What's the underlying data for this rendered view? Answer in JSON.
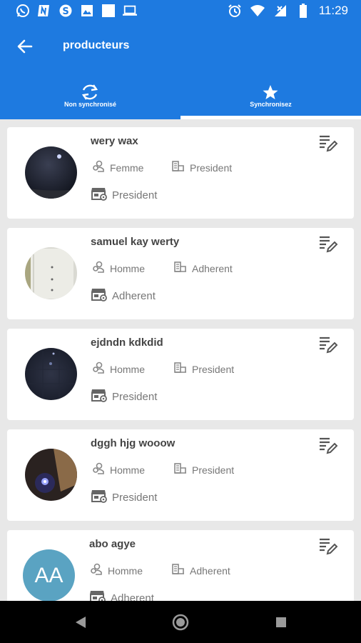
{
  "status_bar": {
    "time": "11:29",
    "left_icons": [
      "whatsapp-icon",
      "n-app-icon",
      "skype-icon",
      "image-icon",
      "square-icon",
      "laptop-icon"
    ],
    "right_icons": [
      "alarm-icon",
      "wifi-icon",
      "no-signal-icon",
      "battery-icon"
    ]
  },
  "app_bar": {
    "title": "producteurs",
    "back_icon": "arrow-back-icon"
  },
  "tabs": [
    {
      "label": "Non synchronisé",
      "icon": "sync-icon",
      "selected": false
    },
    {
      "label": "Synchronisez",
      "icon": "star-icon",
      "selected": true
    }
  ],
  "producers": [
    {
      "name": "wery wax",
      "gender": "Femme",
      "role": "President",
      "group_role": "President",
      "avatar": "photo"
    },
    {
      "name": "samuel kay werty",
      "gender": "Homme",
      "role": "Adherent",
      "group_role": "Adherent",
      "avatar": "photo"
    },
    {
      "name": "ejdndn kdkdid",
      "gender": "Homme",
      "role": "President",
      "group_role": "President",
      "avatar": "photo"
    },
    {
      "name": "dggh hjg wooow",
      "gender": "Homme",
      "role": "President",
      "group_role": "President",
      "avatar": "photo"
    },
    {
      "name": "abo agye",
      "gender": "Homme",
      "role": "Adherent",
      "group_role": "Adherent",
      "avatar": "initials",
      "initials": "AA"
    }
  ],
  "colors": {
    "primary": "#1e7ae0",
    "background": "#e8e8e8",
    "card": "#ffffff",
    "avatar_initials_bg": "#5aa3c2"
  },
  "nav_bar": {
    "buttons": [
      "back-triangle-icon",
      "home-circle-icon",
      "recents-square-icon"
    ]
  }
}
